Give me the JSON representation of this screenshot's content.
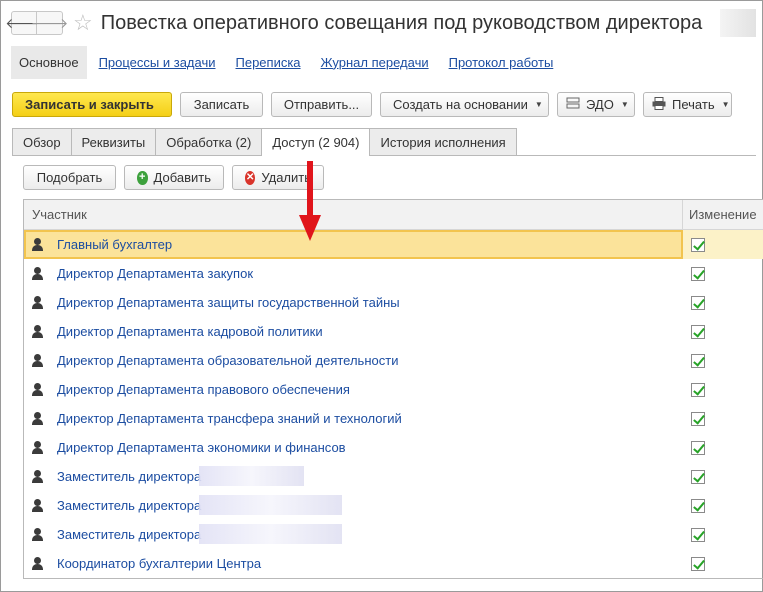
{
  "window": {
    "title": "Повестка оперативного совещания под руководством директора"
  },
  "sections": {
    "active": "Основное",
    "links": [
      "Процессы и задачи",
      "Переписка",
      "Журнал передачи",
      "Протокол работы"
    ]
  },
  "toolbar": {
    "save_close": "Записать и закрыть",
    "save": "Записать",
    "send": "Отправить...",
    "create_based": "Создать на основании",
    "edo": "ЭДО",
    "print": "Печать"
  },
  "tabs": [
    "Обзор",
    "Реквизиты",
    "Обработка (2)",
    "Доступ (2 904)",
    "История исполнения"
  ],
  "active_tab_index": 3,
  "commands": {
    "pick": "Подобрать",
    "add": "Добавить",
    "delete": "Удалить"
  },
  "table": {
    "columns": [
      "Участник",
      "Изменение"
    ],
    "rows": [
      {
        "name": "Главный бухгалтер",
        "change": true,
        "selected": true
      },
      {
        "name": "Директор Департамента закупок",
        "change": true
      },
      {
        "name": "Директор Департамента защиты государственной тайны",
        "change": true
      },
      {
        "name": "Директор Департамента кадровой политики",
        "change": true
      },
      {
        "name": "Директор Департамента образовательной деятельности",
        "change": true
      },
      {
        "name": "Директор Департамента правового обеспечения",
        "change": true
      },
      {
        "name": "Директор Департамента трансфера знаний и технологий",
        "change": true
      },
      {
        "name": "Директор Департамента экономики и финансов",
        "change": true
      },
      {
        "name": "Заместитель директора",
        "change": true
      },
      {
        "name": "Заместитель директора",
        "change": true
      },
      {
        "name": "Заместитель директора",
        "change": true
      },
      {
        "name": "Координатор бухгалтерии Центра",
        "change": true
      }
    ]
  },
  "colors": {
    "accent_yellow": "#f4cf16",
    "link_blue": "#1c4da1",
    "selection": "#fbe39a",
    "annotation_arrow": "#e0141b",
    "check_green": "#27a327"
  }
}
